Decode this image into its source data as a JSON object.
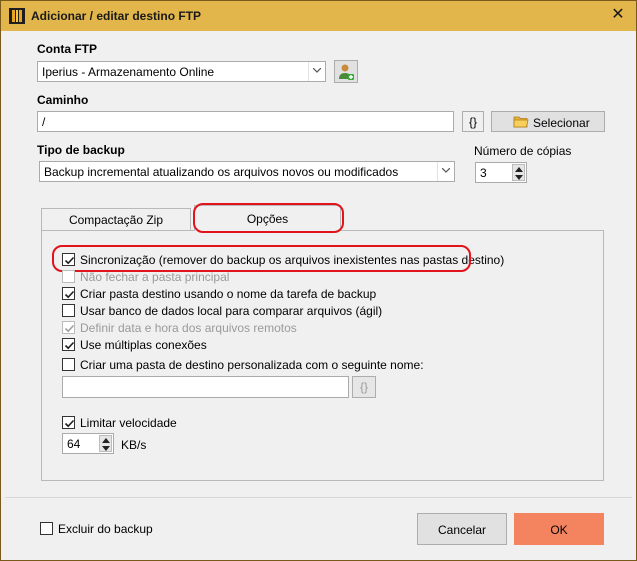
{
  "window": {
    "title": "Adicionar / editar destino FTP",
    "close_glyph": "✕"
  },
  "conta_ftp": {
    "label": "Conta FTP",
    "selected": "Iperius - Armazenamento Online"
  },
  "caminho": {
    "label": "Caminho",
    "value": "/",
    "variables_button": "{}",
    "select_button": "Selecionar"
  },
  "tipo_backup": {
    "label": "Tipo de backup",
    "selected": "Backup incremental atualizando os arquivos novos ou modificados"
  },
  "numero_copias": {
    "label": "Número de cópias",
    "value": "3"
  },
  "tabs": [
    {
      "label": "Compactação Zip",
      "active": false
    },
    {
      "label": "Opções",
      "active": true
    }
  ],
  "options": [
    {
      "label": "Sincronização (remover do backup os arquivos inexistentes nas pastas destino)",
      "checked": true,
      "enabled": true
    },
    {
      "label": "Não fechar a pasta principal",
      "checked": false,
      "enabled": false
    },
    {
      "label": "Criar pasta destino usando o nome da tarefa de backup",
      "checked": true,
      "enabled": true
    },
    {
      "label": "Usar banco de dados local para comparar arquivos (ágil)",
      "checked": false,
      "enabled": true
    },
    {
      "label": "Definir data e hora dos arquivos remotos",
      "checked": true,
      "enabled": false
    },
    {
      "label": "Use múltiplas conexões",
      "checked": true,
      "enabled": true
    },
    {
      "label": "Criar uma pasta de destino personalizada com o seguinte nome:",
      "checked": false,
      "enabled": true
    }
  ],
  "custom_folder": {
    "value": "",
    "variables_button": "{}"
  },
  "speed_limit": {
    "label": "Limitar velocidade",
    "checked": true,
    "value": "64",
    "unit": "KB/s"
  },
  "footer": {
    "exclude_label": "Excluir do backup",
    "exclude_checked": false,
    "cancel_label": "Cancelar",
    "ok_label": "OK"
  },
  "colors": {
    "titlebar": "#e2b64a",
    "ok_button": "#f4845f",
    "highlight": "#e0141a"
  }
}
